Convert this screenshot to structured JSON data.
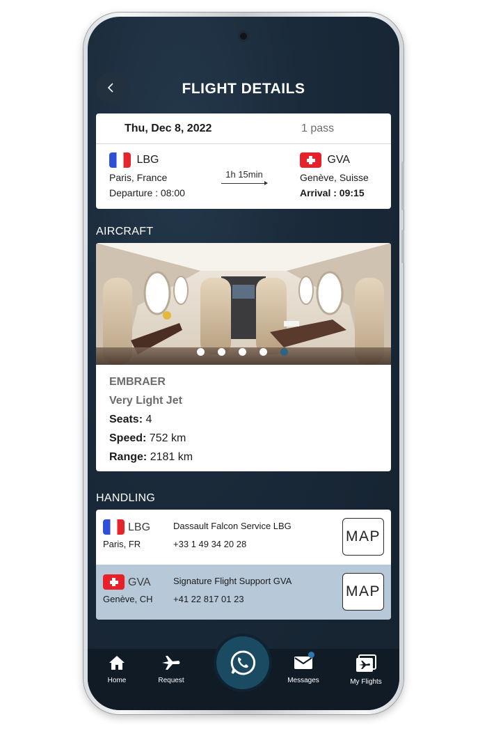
{
  "header": {
    "title": "FLIGHT DETAILS"
  },
  "flight": {
    "date": "Thu, Dec 8, 2022",
    "passengers": "1 pass",
    "departure": {
      "code": "LBG",
      "city": "Paris, France",
      "time": "Departure : 08:00",
      "flag": "fr"
    },
    "arrival": {
      "code": "GVA",
      "city": "Genève, Suisse",
      "time": "Arrival : 09:15",
      "flag": "ch"
    },
    "duration": "1h 15min"
  },
  "aircraft": {
    "section_label": "AIRCRAFT",
    "make": "EMBRAER",
    "class": "Very Light Jet",
    "seats_label": "Seats:",
    "seats_value": "4",
    "speed_label": "Speed:",
    "speed_value": "752 km",
    "range_label": "Range:",
    "range_value": "2181 km",
    "carousel_total": 5,
    "carousel_active": 5
  },
  "handling": {
    "section_label": "HANDLING",
    "items": [
      {
        "code": "LBG",
        "city": "Paris, FR",
        "name": "Dassault Falcon Service LBG",
        "phone": "+33 1 49 34 20 28",
        "map_label": "MAP",
        "flag": "fr"
      },
      {
        "code": "GVA",
        "city": "Genève, CH",
        "name": "Signature Flight Support GVA",
        "phone": "+41 22 817 01 23",
        "map_label": "MAP",
        "flag": "ch"
      }
    ]
  },
  "tabbar": {
    "items": [
      {
        "label": "Home",
        "icon": "home-icon"
      },
      {
        "label": "Request",
        "icon": "airplane-icon"
      },
      {
        "label": "",
        "icon": "whatsapp-icon"
      },
      {
        "label": "Messages",
        "icon": "mail-icon"
      },
      {
        "label": "My Flights",
        "icon": "flight-ticket-icon"
      }
    ]
  },
  "colors": {
    "background": "#1a2a3a",
    "accent": "#2c6483",
    "handling_highlight": "#b7c8d8",
    "tabbar": "#101b26"
  }
}
